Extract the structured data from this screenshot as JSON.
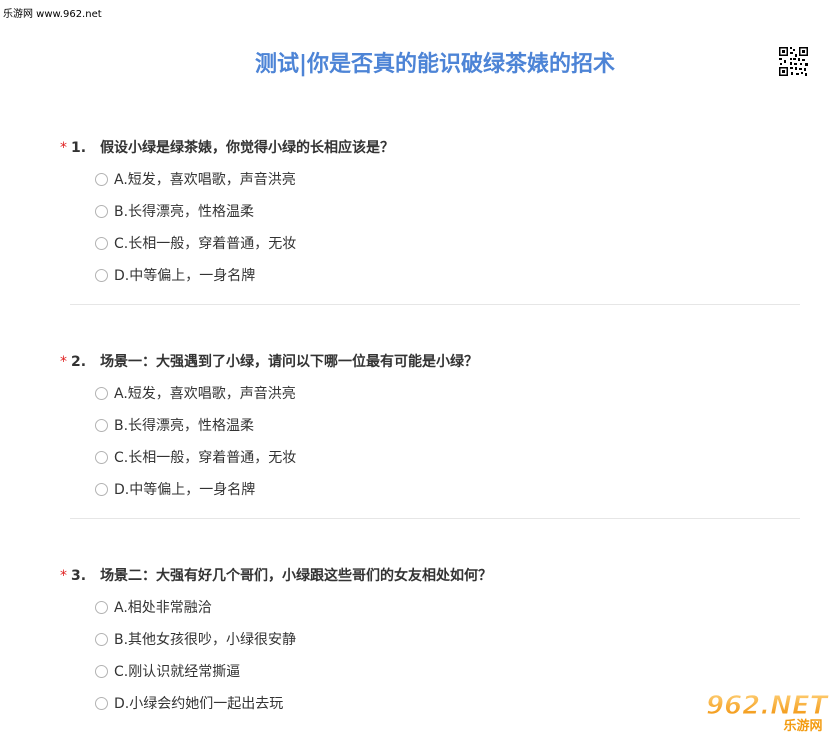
{
  "watermark": "乐游网 www.962.net",
  "title": "测试|你是否真的能识破绿茶婊的招术",
  "questions": [
    {
      "star": "*",
      "number": "1.",
      "text": "假设小绿是绿茶婊，你觉得小绿的长相应该是？",
      "options": [
        "A.短发，喜欢唱歌，声音洪亮",
        "B.长得漂亮，性格温柔",
        "C.长相一般，穿着普通，无妆",
        "D.中等偏上，一身名牌"
      ]
    },
    {
      "star": "*",
      "number": "2.",
      "text": "场景一：大强遇到了小绿，请问以下哪一位最有可能是小绿？",
      "options": [
        "A.短发，喜欢唱歌，声音洪亮",
        "B.长得漂亮，性格温柔",
        "C.长相一般，穿着普通，无妆",
        "D.中等偏上，一身名牌"
      ]
    },
    {
      "star": "*",
      "number": "3.",
      "text": "场景二：大强有好几个哥们，小绿跟这些哥们的女友相处如何？",
      "options": [
        "A.相处非常融洽",
        "B.其他女孩很吵，小绿很安静",
        "C.刚认识就经常撕逼",
        "D.小绿会约她们一起出去玩"
      ]
    }
  ],
  "logo": {
    "main": "962.NET",
    "sub": "乐游网",
    "color": "#f39c12"
  }
}
